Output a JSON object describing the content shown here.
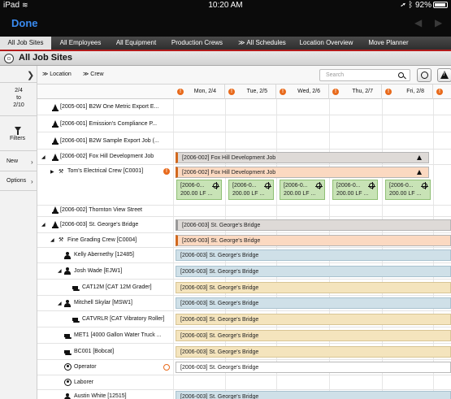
{
  "status_bar": {
    "device": "iPad",
    "time": "10:20 AM",
    "battery": "92%"
  },
  "nav": {
    "done_label": "Done",
    "back_arrow": "◀",
    "forward_arrow": "▶"
  },
  "tabs": [
    "All Job Sites",
    "All Employees",
    "All Equipment",
    "Production Crews",
    "All Schedules",
    "Location Overview",
    "Move Planner"
  ],
  "active_tab": 0,
  "title": "All Job Sites",
  "left_pane": {
    "range_start": "2/4",
    "range_to": "to",
    "range_end": "2/10",
    "filters_label": "Filters",
    "new_label": "New",
    "options_label": "Options"
  },
  "toolbar": {
    "location_label": "Location",
    "crew_label": "Crew",
    "search_placeholder": "Search"
  },
  "days": [
    "Mon, 2/4",
    "Tue, 2/5",
    "Wed, 2/6",
    "Thu, 2/7",
    "Fri, 2/8"
  ],
  "tree": {
    "job_2005_001": "[2005-001] B2W One Metric Export E...",
    "job_2006_001": "[2006-001] Emission's Compliance P...",
    "job_2006_001b": "[2006-001] B2W Sample Export Job (...",
    "job_2006_002": "[2006-002] Fox Hill Development Job",
    "crew_toms": "Tom's Electrical Crew [C0001]",
    "job_2006_002b": "[2006-002] Thornton View Street",
    "job_2006_003": "[2006-003] St. George's Bridge",
    "crew_grading": "Fine Grading Crew [C0004]",
    "emp_kelly": "Kelly Abernethy [12485]",
    "emp_josh": "Josh Wade [EJW1]",
    "eq_cat12m": "CAT12M [CAT 12M Grader]",
    "emp_mitchell": "Mitchell Skylar [MSW1]",
    "eq_catvrlr": "CATVRLR [CAT Vibratory Roller]",
    "eq_met1": "MET1 [4000 Gallon Water Truck ...",
    "eq_bc001": "BC001 [Bobcat]",
    "role_operator": "Operator",
    "role_laborer": "Laborer",
    "emp_austin": "Austin White [12515]"
  },
  "bars": {
    "fox_hill": "[2006-002] Fox Hill Development Job",
    "fox_hill_crew": "[2006-002] Fox Hill Development Job",
    "st_george": "[2006-003] St. George's Bridge"
  },
  "tasks": [
    {
      "line1": "[2006-0...",
      "line2": "200.00 LF ..."
    },
    {
      "line1": "[2006-0...",
      "line2": "200.00 LF ..."
    },
    {
      "line1": "[2006-0...",
      "line2": "200.00 LF ..."
    },
    {
      "line1": "[2006-0...",
      "line2": "200.00 LF ..."
    },
    {
      "line1": "[2006-0...",
      "line2": "200.00 LF ..."
    }
  ],
  "alert_glyph": "!",
  "colors": {
    "accent_red": "#b31b1b",
    "done_blue": "#3a8bf0",
    "alert_orange": "#e86a1c",
    "task_green": "#c8e3b6",
    "bar_blue": "#cfe0e8",
    "bar_tan": "#f4e4bd",
    "bar_peach": "#fbd9c1"
  }
}
